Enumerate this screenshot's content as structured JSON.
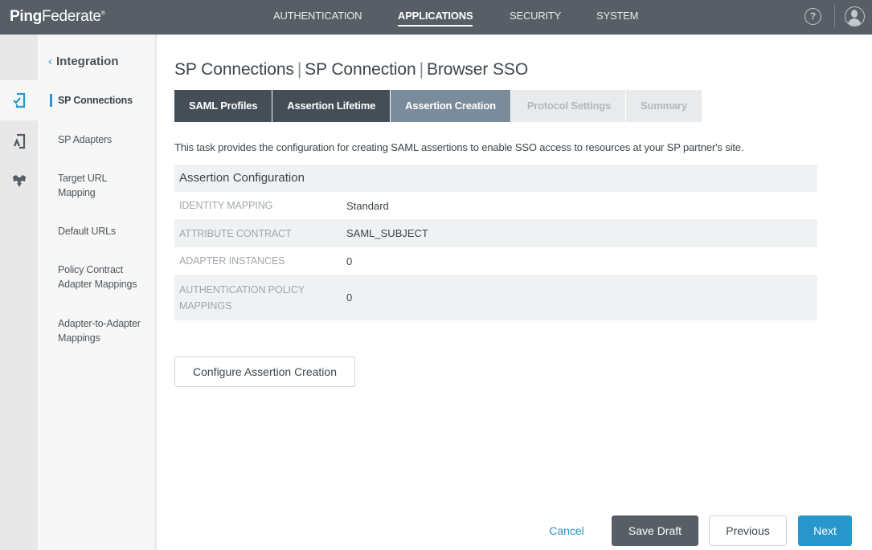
{
  "app": {
    "logo_bold": "Ping",
    "logo_light": "Federate",
    "logo_mark": "®"
  },
  "topnav": {
    "items": [
      {
        "label": "AUTHENTICATION",
        "active": false
      },
      {
        "label": "APPLICATIONS",
        "active": true
      },
      {
        "label": "SECURITY",
        "active": false
      },
      {
        "label": "SYSTEM",
        "active": false
      }
    ],
    "help_glyph": "?",
    "icons": [
      "help-icon",
      "user-icon"
    ]
  },
  "rail": {
    "items": [
      {
        "icon": "connection-check-icon",
        "active": true,
        "color": "#2996cc"
      },
      {
        "icon": "adapter-icon",
        "active": false,
        "color": "#555d64"
      },
      {
        "icon": "oauth-icon",
        "active": false,
        "color": "#555d64"
      }
    ]
  },
  "subnav": {
    "back_glyph": "‹",
    "back_label": "Integration",
    "items": [
      {
        "label": "SP Connections",
        "active": true
      },
      {
        "label": "SP Adapters",
        "active": false
      },
      {
        "label": "Target URL Mapping",
        "active": false
      },
      {
        "label": "Default URLs",
        "active": false
      },
      {
        "label": "Policy Contract Adapter Mappings",
        "active": false
      },
      {
        "label": "Adapter-to-Adapter Mappings",
        "active": false
      }
    ]
  },
  "breadcrumb": {
    "parts": [
      "SP Connections",
      "SP Connection",
      "Browser SSO"
    ],
    "separator": "|"
  },
  "tabs": [
    {
      "label": "SAML Profiles",
      "state": "done"
    },
    {
      "label": "Assertion Lifetime",
      "state": "done"
    },
    {
      "label": "Assertion Creation",
      "state": "current"
    },
    {
      "label": "Protocol Settings",
      "state": "pending"
    },
    {
      "label": "Summary",
      "state": "pending"
    }
  ],
  "description": "This task provides the configuration for creating SAML assertions to enable SSO access to resources at your SP partner's site.",
  "assertion_config": {
    "title": "Assertion Configuration",
    "rows": [
      {
        "key": "IDENTITY MAPPING",
        "value": "Standard"
      },
      {
        "key": "ATTRIBUTE CONTRACT",
        "value": "SAML_SUBJECT"
      },
      {
        "key": "ADAPTER INSTANCES",
        "value": "0"
      },
      {
        "key": "AUTHENTICATION POLICY MAPPINGS",
        "value": "0"
      }
    ]
  },
  "configure_button": "Configure Assertion Creation",
  "footer": {
    "cancel": "Cancel",
    "save_draft": "Save Draft",
    "previous": "Previous",
    "next": "Next"
  },
  "colors": {
    "accent": "#2996cc",
    "topbar": "#575e66",
    "tab_done": "#454e57",
    "tab_current": "#7a8b9b"
  }
}
